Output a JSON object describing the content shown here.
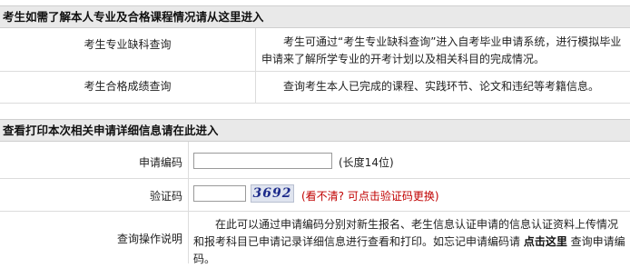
{
  "section1": {
    "header": "考生如需了解本人专业及合格课程情况请从这里进入",
    "rows": [
      {
        "label": "考生专业缺科查询",
        "desc": "考生可通过“考生专业缺科查询”进入自考毕业申请系统，进行模拟毕业申请来了解所学专业的开考计划以及相关科目的完成情况。"
      },
      {
        "label": "考生合格成绩查询",
        "desc": "查询考生本人已完成的课程、实践环节、论文和违纪等考籍信息。"
      }
    ]
  },
  "section2": {
    "header": "查看打印本次相关申请详细信息请在此进入",
    "code_field": {
      "label": "申请编码",
      "value": "",
      "placeholder": "",
      "hint": "(长度14位)"
    },
    "captcha_field": {
      "label": "验证码",
      "value": "",
      "captcha_text": "3692",
      "refresh_hint": "(看不清? 可点击验证码更换)"
    },
    "instruction": {
      "label": "查询操作说明",
      "text_before": "在此可以通过申请编码分别对新生报名、老生信息认证申请的信息认证资料上传情况和报考科目已申请记录详细信息进行查看和打印。如忘记申请编码请 ",
      "link": "点击这里",
      "text_after": " 查询申请编码。"
    }
  }
}
